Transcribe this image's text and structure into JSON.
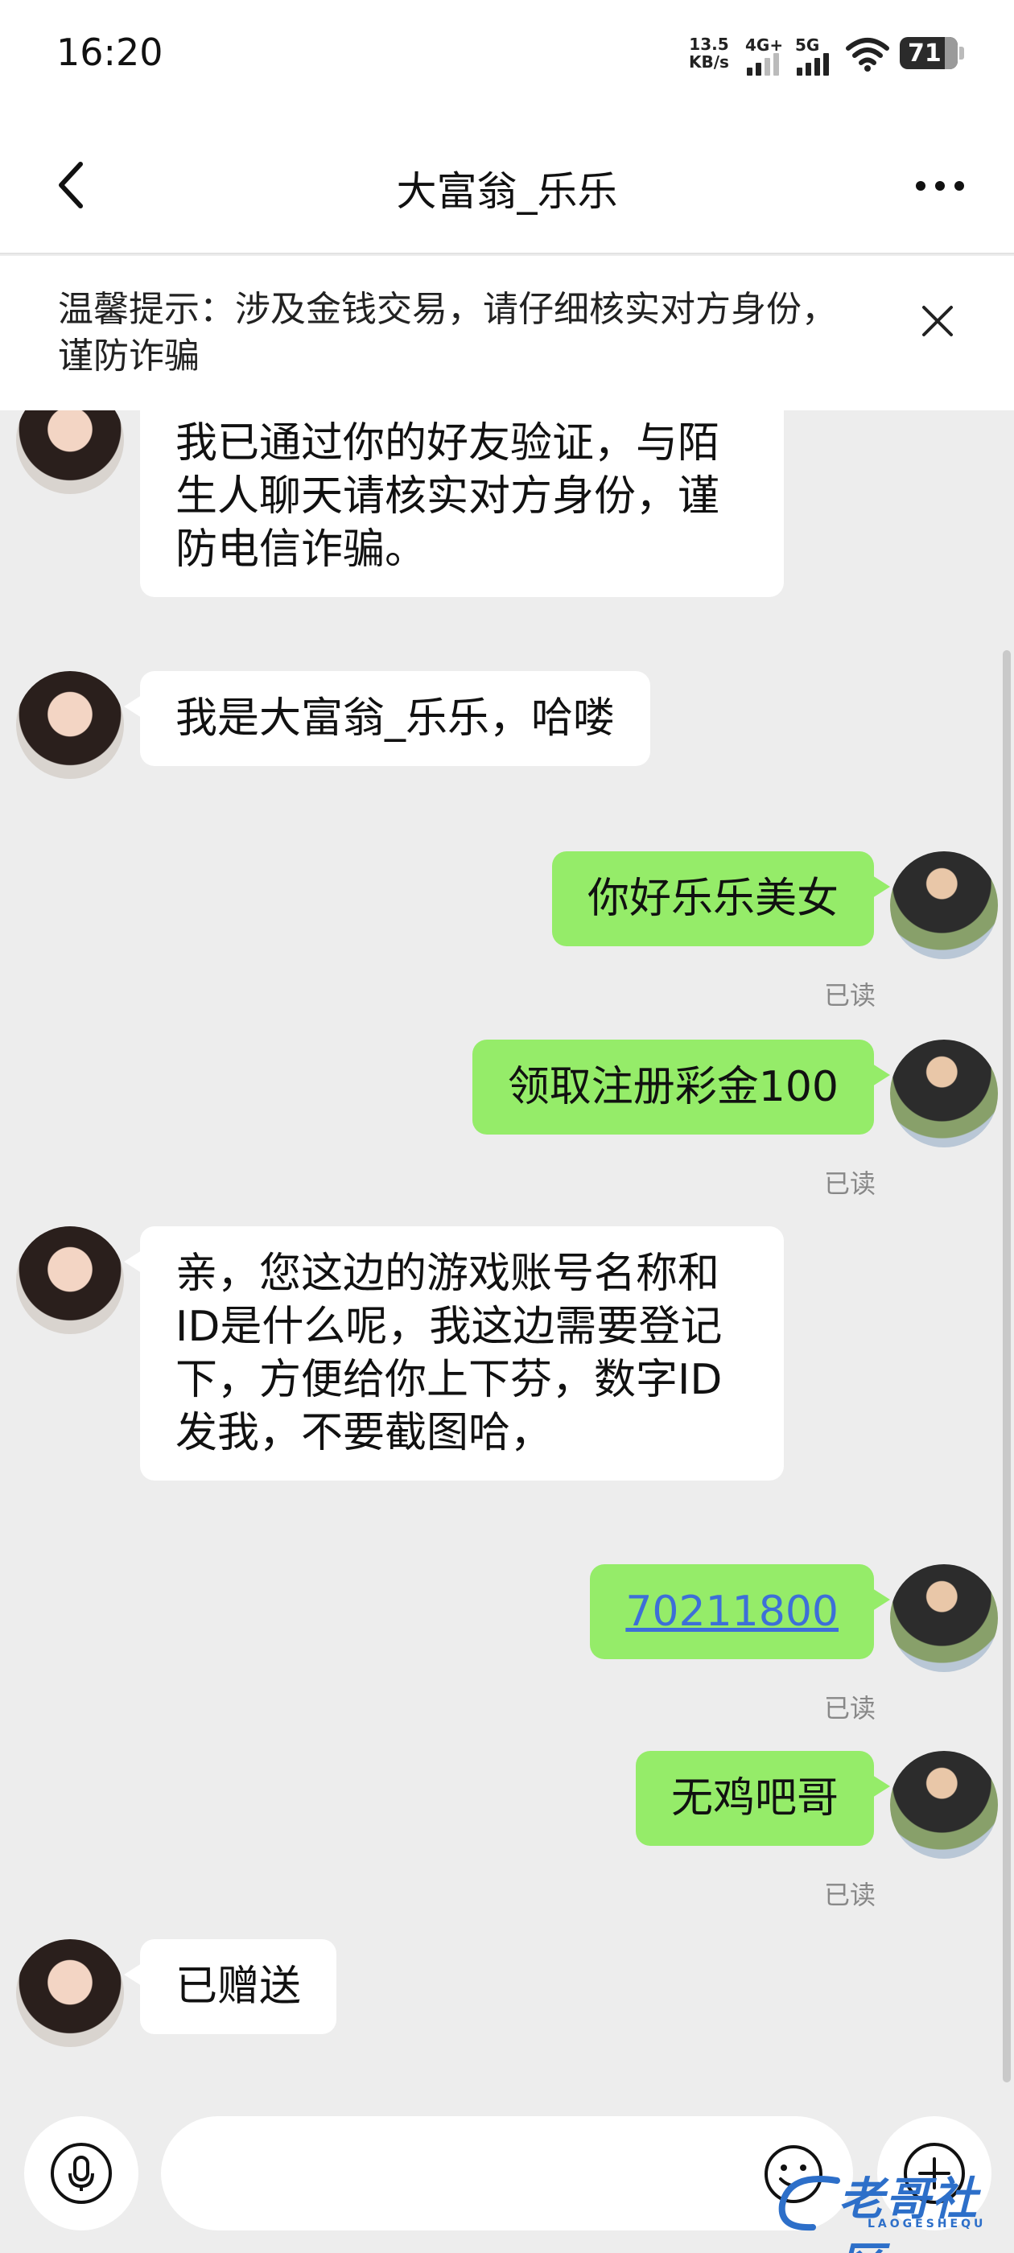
{
  "status_bar": {
    "time": "16:20",
    "net_speed_value": "13.5",
    "net_speed_unit": "KB/s",
    "signal_1_label": "4G+",
    "signal_2_label": "5G",
    "battery": "71"
  },
  "header": {
    "title": "大富翁_乐乐"
  },
  "warning": {
    "text": "温馨提示：涉及金钱交易，请仔细核实对方身份，谨防诈骗"
  },
  "messages": [
    {
      "side": "left",
      "text": "我已通过你的好友验证，与陌生人聊天请核实对方身份，谨防电信诈骗。"
    },
    {
      "side": "left",
      "text": "我是大富翁_乐乐，哈喽"
    },
    {
      "side": "right",
      "text": "你好乐乐美女",
      "status": "已读"
    },
    {
      "side": "right",
      "text": "领取注册彩金100",
      "status": "已读"
    },
    {
      "side": "left",
      "text": "亲，您这边的游戏账号名称和ID是什么呢，我这边需要登记下，方便给你上下芬，数字ID发我，不要截图哈，"
    },
    {
      "side": "right",
      "text": "70211800",
      "status": "已读"
    },
    {
      "side": "right",
      "text": "无鸡吧哥",
      "status": "已读"
    },
    {
      "side": "left",
      "text": "已赠送"
    }
  ],
  "input": {
    "placeholder": ""
  },
  "watermark": {
    "text": "老哥社区",
    "sub": "LAOGESHEQU"
  },
  "colors": {
    "self_bubble": "#95ec69",
    "other_bubble": "#ffffff",
    "background": "#ededed",
    "link": "#3d6fd8"
  }
}
